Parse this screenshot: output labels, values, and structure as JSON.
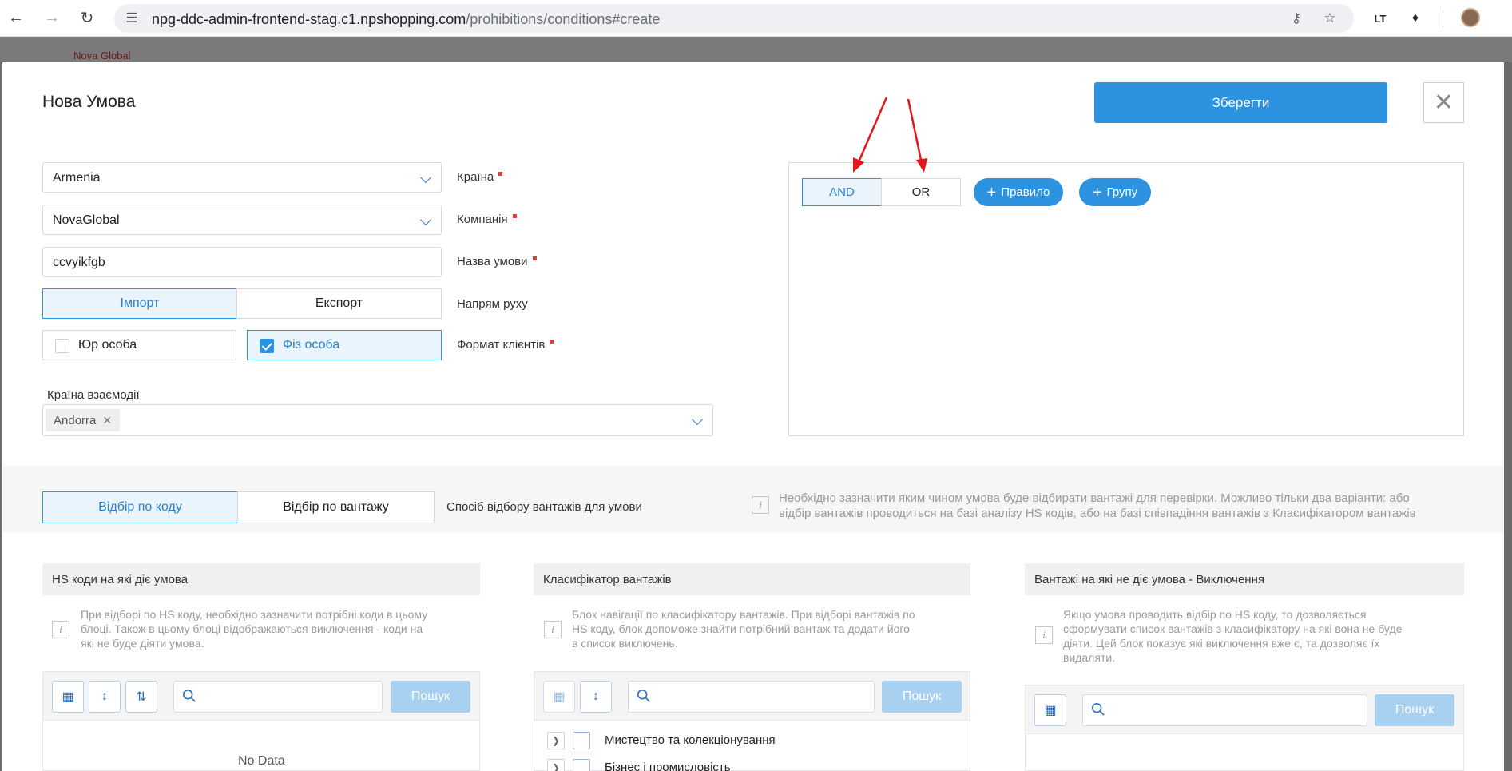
{
  "browser": {
    "url_host": "npg-ddc-admin-frontend-stag.c1.npshopping.com",
    "url_path": "/prohibitions/conditions#create",
    "ext_label": "LT"
  },
  "background": {
    "logo": "Nova Global"
  },
  "modal": {
    "title": "Нова Умова",
    "save_label": "Зберегти",
    "close_symbol": "✕"
  },
  "form": {
    "country": {
      "value": "Armenia",
      "label": "Країна"
    },
    "company": {
      "value": "NovaGlobal",
      "label": "Компанія"
    },
    "condition_name": {
      "value": "ccvyikfgb",
      "label": "Назва умови"
    },
    "direction": {
      "options": [
        "Імпорт",
        "Експорт"
      ],
      "label": "Напрям руху"
    },
    "client_format": {
      "options": [
        {
          "label": "Юр особа",
          "checked": false
        },
        {
          "label": "Фіз особа",
          "checked": true
        }
      ],
      "label": "Формат клієнтів"
    },
    "interaction_country": {
      "label": "Країна взаємодії",
      "tags": [
        "Andorra"
      ]
    }
  },
  "builder": {
    "logic": [
      "AND",
      "OR"
    ],
    "add_rule": "Правило",
    "add_group": "Групу"
  },
  "selection": {
    "options": [
      "Відбір по коду",
      "Відбір по вантажу"
    ],
    "label": "Спосіб відбору вантажів для умови",
    "hint_line1": "Необхідно зазначити яким чином умова буде відбирати вантажі для перевірки. Можливо тільки два варіанти: або",
    "hint_line2": "відбір вантажів проводиться на базі аналізу HS кодів, або на базі співпадіння вантажів з Класифікатором вантажів"
  },
  "columns": [
    {
      "title": "HS коди на які діє умова",
      "hint": [
        "При відборі по HS коду, необхідно зазначити потрібні коди в цьому",
        "блоці. Також в цьому блоці відображаються виключення - коди на",
        "які не буде діяти умова."
      ],
      "search_label": "Пошук",
      "empty": "No Data"
    },
    {
      "title": "Класифікатор вантажів",
      "hint": [
        "Блок навігації по класифікатору вантажів. При відборі вантажів по",
        "HS коду, блок допоможе знайти потрібний вантаж та додати його",
        "в список виключень."
      ],
      "search_label": "Пошук",
      "tree": [
        "Мистецтво та колекціонування",
        "Бізнес і промисловість"
      ]
    },
    {
      "title": "Вантажі на які не діє умова - Виключення",
      "hint": [
        "Якщо умова проводить відбір по HS коду, то дозволяється",
        "сформувати список вантажів з класифікатору на які вона не буде",
        "діяти. Цей блок показує які виключення вже є, та дозволяє їх",
        "видаляти."
      ],
      "search_label": "Пошук"
    }
  ],
  "colors": {
    "accent": "#2d93e0",
    "required": "#e53935",
    "arrow": "#e3161d"
  }
}
